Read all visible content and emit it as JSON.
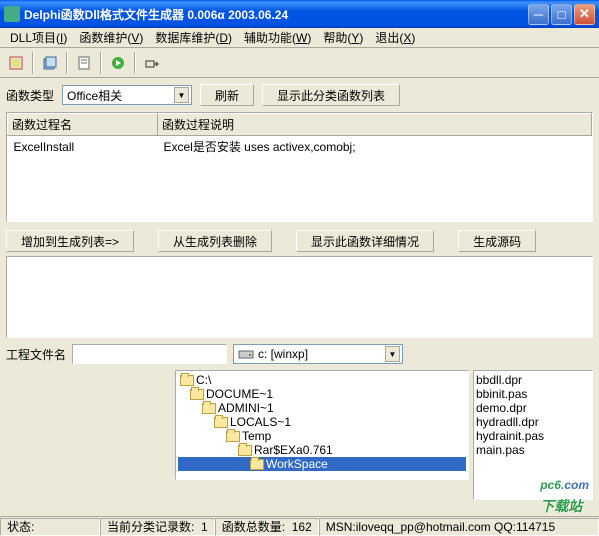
{
  "title": "Delphi函数Dll格式文件生成器   0.006α   2003.06.24",
  "menu": {
    "m0": "DLL项目(",
    "k0": "I",
    "m0b": ")",
    "m1": "函数维护(",
    "k1": "V",
    "m1b": ")",
    "m2": "数据库维护(",
    "k2": "D",
    "m2b": ")",
    "m3": "辅助功能(",
    "k3": "W",
    "m3b": ")",
    "m4": "帮助(",
    "k4": "Y",
    "m4b": ")",
    "m5": "退出(",
    "k5": "X",
    "m5b": ")"
  },
  "row1": {
    "label": "函数类型",
    "combo": "Office相关",
    "refresh": "刷新",
    "showlist": "显示此分类函数列表"
  },
  "table": {
    "col1": "函数过程名",
    "col2": "函数过程说明",
    "c1": "ExcelInstall",
    "c2": "Excel是否安装      uses activex,comobj;"
  },
  "row2": {
    "b1": "增加到生成列表=>",
    "b2": "从生成列表删除",
    "b3": "显示此函数详细情况",
    "b4": "生成源码"
  },
  "row3": {
    "label": "工程文件名",
    "drive": "c: [winxp]"
  },
  "tree": {
    "r": "C:\\",
    "d1": "DOCUME~1",
    "d2": "ADMINI~1",
    "d3": "LOCALS~1",
    "d4": "Temp",
    "d5": "Rar$EXa0.761",
    "d6": "WorkSpace"
  },
  "files": {
    "f0": "bbdll.dpr",
    "f1": "bbinit.pas",
    "f2": "demo.dpr",
    "f3": "hydradll.dpr",
    "f4": "hydrainit.pas",
    "f5": "main.pas"
  },
  "status": {
    "s1": "状态:",
    "s2l": "当前分类记录数:",
    "s2v": "1",
    "s3l": "函数总数量:",
    "s3v": "162",
    "s4": "MSN:iloveqq_pp@hotmail.com    QQ:114715"
  },
  "watermark": {
    "en": "pc6",
    "cn": "下载站"
  }
}
